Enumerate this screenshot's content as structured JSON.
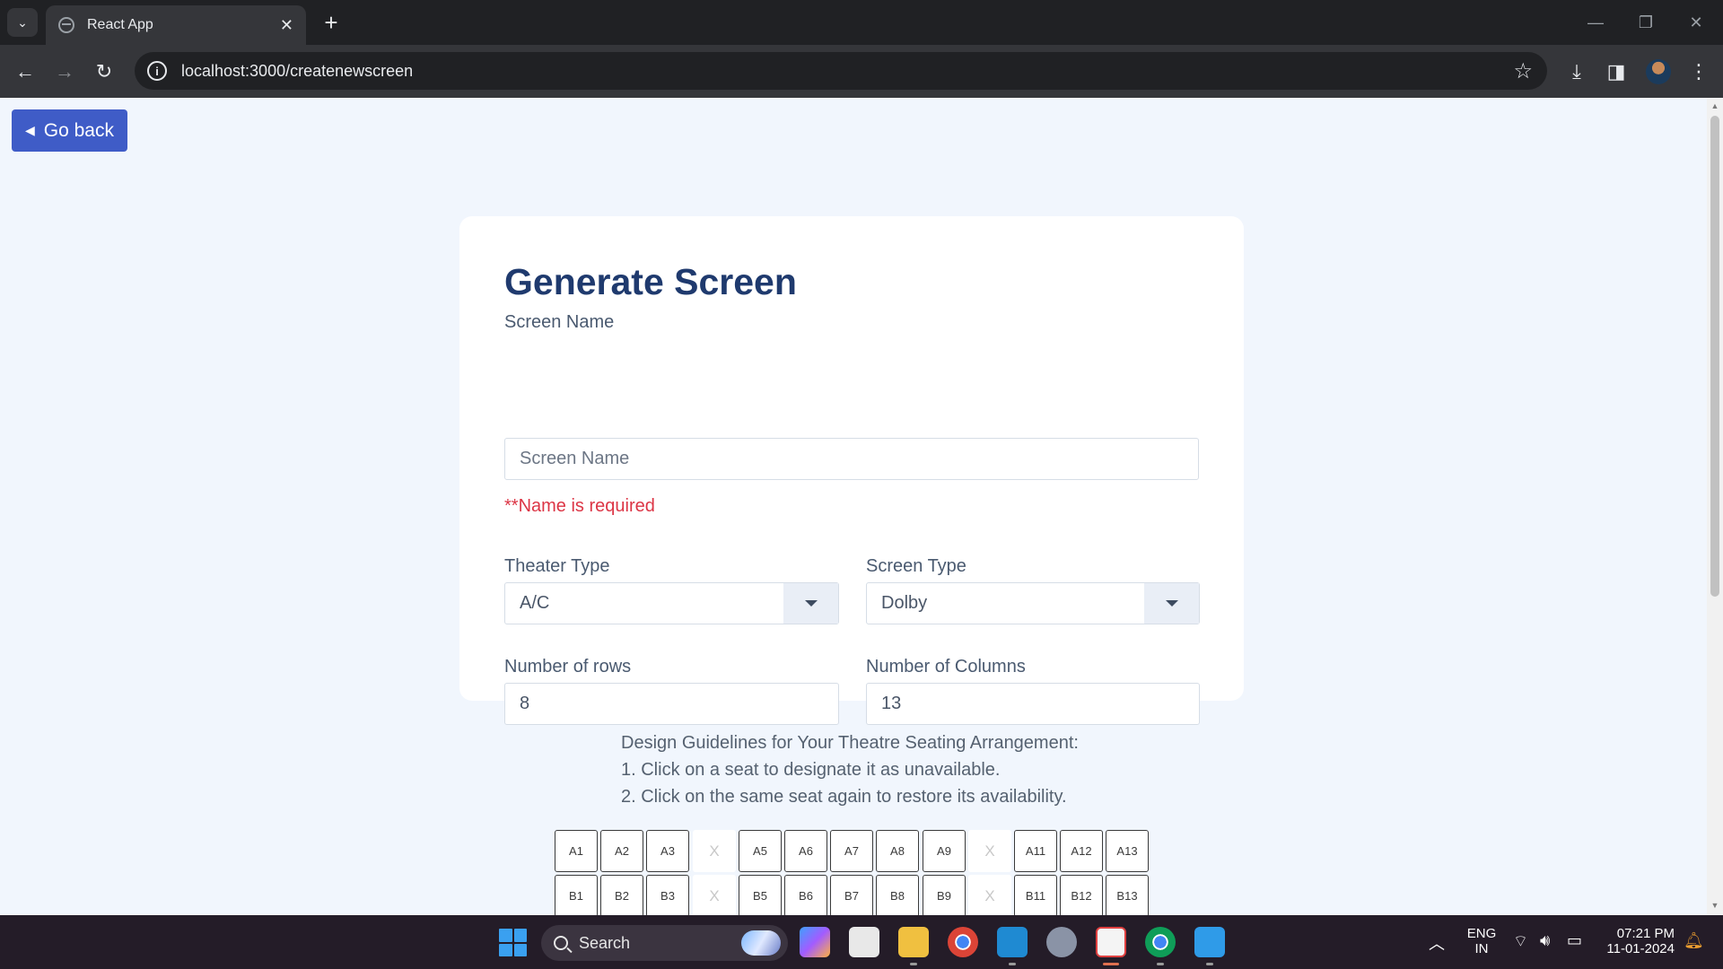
{
  "browser": {
    "tab_title": "React App",
    "new_tab_glyph": "+",
    "tab_close_glyph": "✕",
    "url": "localhost:3000/createnewscreen",
    "controls": {
      "minimize": "—",
      "restore": "❐",
      "close": "✕"
    }
  },
  "page": {
    "go_back_label": "Go back",
    "form": {
      "title": "Generate Screen",
      "screen_name_label": "Screen Name",
      "screen_name_placeholder": "Screen Name",
      "screen_name_value": "",
      "name_error": "**Name is required",
      "theater_type_label": "Theater Type",
      "theater_type_value": "A/C",
      "screen_type_label": "Screen Type",
      "screen_type_value": "Dolby",
      "rows_label": "Number of rows",
      "rows_value": "8",
      "columns_label": "Number of Columns",
      "columns_value": "13"
    },
    "guidelines": {
      "heading": "Design Guidelines for Your Theatre Seating Arrangement:",
      "step1": "1. Click on a seat to designate it as unavailable.",
      "step2": "2. Click on the same seat again to restore its availability."
    },
    "seat_rows": [
      [
        "A1",
        "A2",
        "A3",
        "X",
        "A5",
        "A6",
        "A7",
        "A8",
        "A9",
        "X",
        "A11",
        "A12",
        "A13"
      ],
      [
        "B1",
        "B2",
        "B3",
        "X",
        "B5",
        "B6",
        "B7",
        "B8",
        "B9",
        "X",
        "B11",
        "B12",
        "B13"
      ]
    ]
  },
  "taskbar": {
    "search_label": "Search",
    "language": "ENG",
    "region": "IN",
    "time": "07:21 PM",
    "date": "11-01-2024",
    "apps": [
      "copilot-icon",
      "task-view-icon",
      "file-explorer-icon",
      "chrome-icon",
      "vscode-icon",
      "settings-icon",
      "snipping-tool-icon",
      "chrome-profile-icon",
      "notepad-icon"
    ]
  },
  "colors": {
    "primary_button": "#3f5cc7",
    "page_background": "#f1f6fd",
    "title": "#1f3a6e",
    "error": "#dc3545"
  }
}
